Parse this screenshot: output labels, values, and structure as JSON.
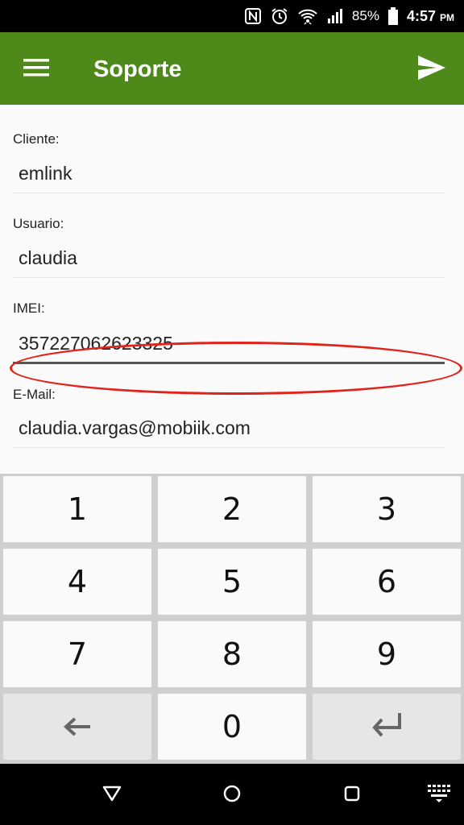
{
  "status_bar": {
    "icons": [
      "nfc-icon",
      "alarm-icon",
      "wifi-icon",
      "signal-icon",
      "battery-icon"
    ],
    "battery": "85%",
    "time": "4:57",
    "ampm": "PM"
  },
  "app_bar": {
    "title": "Soporte",
    "menu_icon": "hamburger-menu-icon",
    "action_icon": "send-icon",
    "color": "#4e8a1a"
  },
  "form": {
    "fields": [
      {
        "label": "Cliente:",
        "value": "emlink"
      },
      {
        "label": "Usuario:",
        "value": "claudia"
      },
      {
        "label": "IMEI:",
        "value": "357227062623325"
      },
      {
        "label": "E-Mail:",
        "value": "claudia.vargas@mobiik.com"
      }
    ],
    "annotation_color": "#e0241b"
  },
  "keypad": {
    "keys": [
      "1",
      "2",
      "3",
      "4",
      "5",
      "6",
      "7",
      "8",
      "9",
      "backspace-icon",
      "0",
      "enter-icon"
    ]
  },
  "nav_bar": {
    "icons": [
      "back-icon",
      "home-icon",
      "recents-icon",
      "keyboard-switch-icon"
    ]
  }
}
